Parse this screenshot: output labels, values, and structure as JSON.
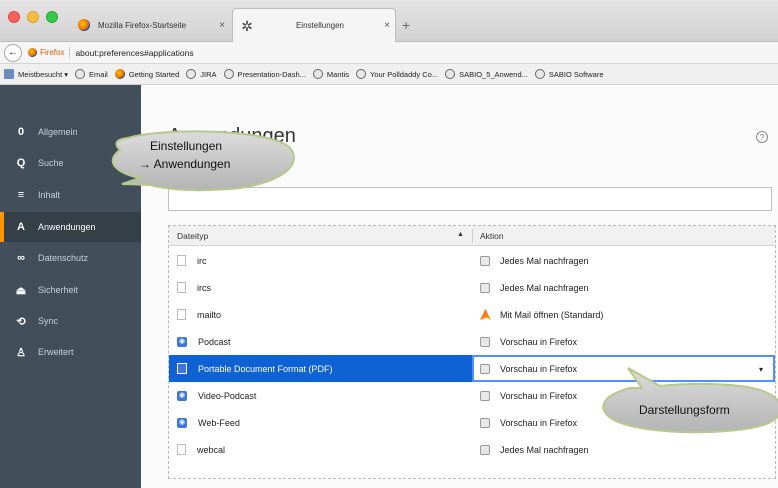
{
  "tabs": [
    {
      "label": "Mozilla Firefox-Startseite",
      "close": "×",
      "icon": "firefox-icon"
    },
    {
      "label": "Einstellungen",
      "close": "×",
      "icon": "gear-icon"
    }
  ],
  "new_tab": "+",
  "nav": {
    "back": "←",
    "identity_label": "Firefox",
    "url": "about:preferences#applications"
  },
  "bookmarks": [
    {
      "label": "Meistbesucht ▾",
      "icon": "folder-icon"
    },
    {
      "label": "Email",
      "icon": "globe-icon"
    },
    {
      "label": "Getting Started",
      "icon": "firefox-icon"
    },
    {
      "label": "JIRA",
      "icon": "globe-icon"
    },
    {
      "label": "Presentation-Dash...",
      "icon": "globe-icon"
    },
    {
      "label": "Mantis",
      "icon": "globe-icon"
    },
    {
      "label": "Your Polldaddy Co...",
      "icon": "globe-icon"
    },
    {
      "label": "SABIO_5_Anwend...",
      "icon": "globe-icon"
    },
    {
      "label": "SABIO Software",
      "icon": "globe-icon"
    }
  ],
  "sidebar": {
    "items": [
      {
        "label": "Allgemein",
        "icon": "0"
      },
      {
        "label": "Suche",
        "icon": "Q"
      },
      {
        "label": "Inhalt",
        "icon": "≡"
      },
      {
        "label": "Anwendungen",
        "icon": "A"
      },
      {
        "label": "Datenschutz",
        "icon": "∞"
      },
      {
        "label": "Sicherheit",
        "icon": "⏏"
      },
      {
        "label": "Sync",
        "icon": "⟲"
      },
      {
        "label": "Erweitert",
        "icon": "♙"
      }
    ],
    "active_index": 3
  },
  "main": {
    "title": "Anwendungen",
    "help": "?",
    "table": {
      "col_type": "Dateityp",
      "sort_indicator": "▲",
      "col_action": "Aktion",
      "rows": [
        {
          "type": "irc",
          "action": "Jedes Mal nachfragen",
          "type_icon": "file",
          "action_icon": "ask"
        },
        {
          "type": "ircs",
          "action": "Jedes Mal nachfragen",
          "type_icon": "file",
          "action_icon": "ask"
        },
        {
          "type": "mailto",
          "action": "Mit Mail öffnen (Standard)",
          "type_icon": "file",
          "action_icon": "mail"
        },
        {
          "type": "Podcast",
          "action": "Vorschau in Firefox",
          "type_icon": "rss",
          "action_icon": "ask"
        },
        {
          "type": "Portable Document Format (PDF)",
          "action": "Vorschau in Firefox",
          "type_icon": "pdf",
          "action_icon": "ask"
        },
        {
          "type": "Video-Podcast",
          "action": "Vorschau in Firefox",
          "type_icon": "rss",
          "action_icon": "ask"
        },
        {
          "type": "Web-Feed",
          "action": "Vorschau in Firefox",
          "type_icon": "rss",
          "action_icon": "ask"
        },
        {
          "type": "webcal",
          "action": "Jedes Mal nachfragen",
          "type_icon": "file",
          "action_icon": "ask"
        }
      ],
      "selected_index": 4,
      "dropdown_caret": "▾"
    }
  },
  "callouts": {
    "settings_line1": "Einstellungen",
    "settings_line2": "→ Anwendungen",
    "display_form": "Darstellungsform"
  }
}
